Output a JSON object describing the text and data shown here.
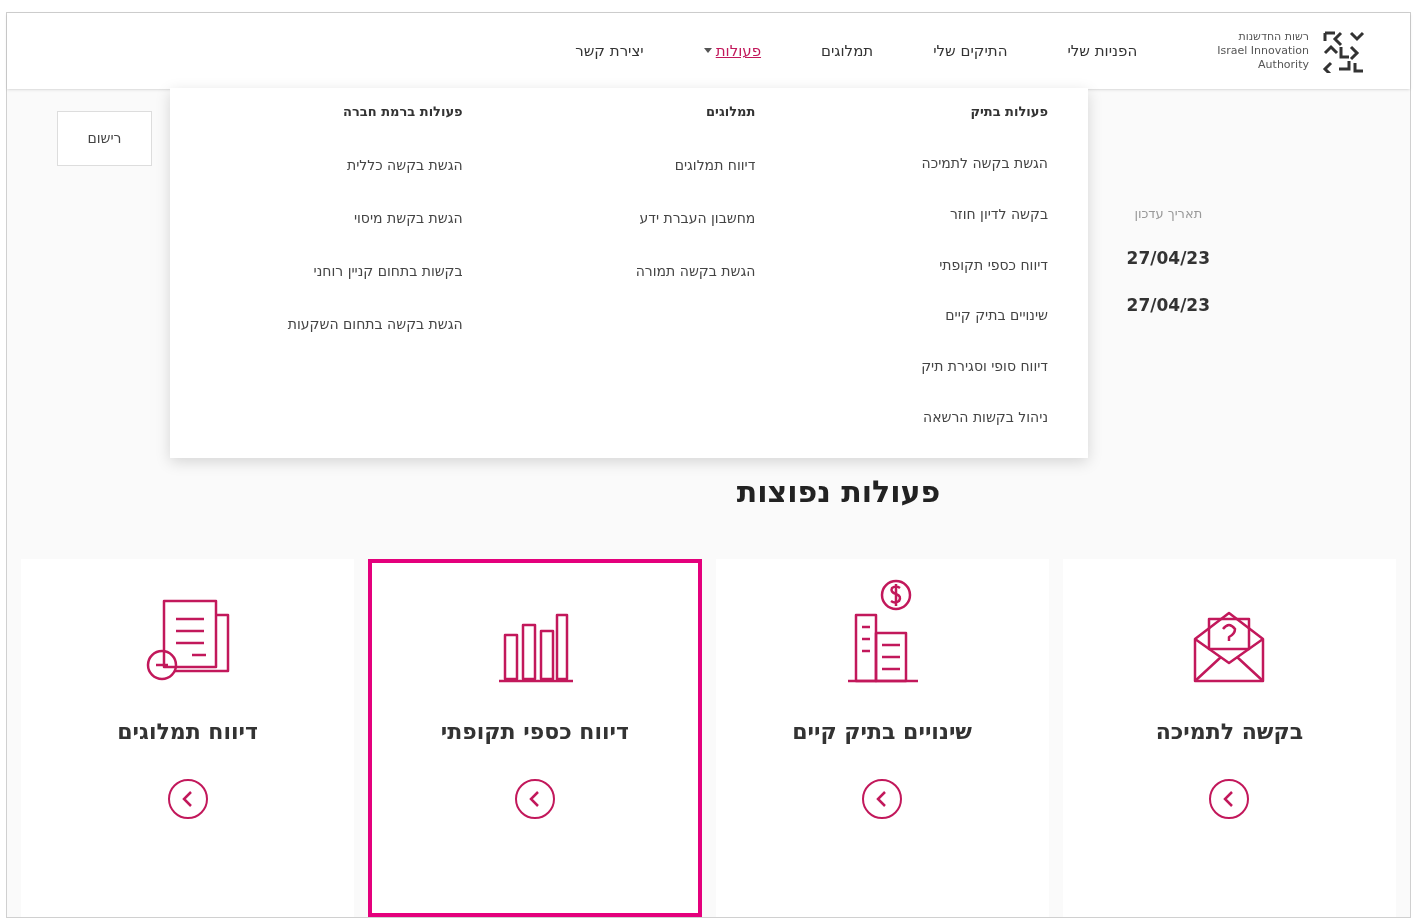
{
  "logo": {
    "lines": [
      "רשות החדשנות",
      "Israel Innovation",
      "Authority"
    ]
  },
  "nav": [
    {
      "label": "הפניות שלי",
      "selected": false,
      "kind": "link"
    },
    {
      "label": "התיקים שלי",
      "selected": false,
      "kind": "link"
    },
    {
      "label": "תמלוגים",
      "selected": false,
      "kind": "link"
    },
    {
      "label": "פעולות",
      "selected": true,
      "kind": "dropdown"
    },
    {
      "label": "יצירת קשר",
      "selected": false,
      "kind": "link"
    }
  ],
  "background": {
    "register_button": "רישום",
    "date_header": "תאריך עדכון",
    "dates": [
      "27/04/23",
      "27/04/23"
    ]
  },
  "dropdown": {
    "columns": [
      {
        "title": "פעולות בתיק",
        "items": [
          "הגשת בקשה לתמיכה",
          "בקשה לדיון חוזר",
          "דיווח כספי תקופתי",
          "שינויים בתיק קיים",
          "דיווח סופי וסגירת תיק",
          "ניהול בקשות הרשאה"
        ]
      },
      {
        "title": "תמלוגים",
        "items": [
          "דיווח תמלוגים",
          "מחשבון העברת ידע",
          "הגשת בקשה תמורה"
        ]
      },
      {
        "title": "פעולות ברמת חברה",
        "items": [
          "הגשת בקשה כללית",
          "הגשת בקשת מיסוי",
          "בקשות בתחום קניין רוחני",
          "הגשת בקשה בתחום השקעות"
        ]
      }
    ]
  },
  "section_title": "פעולות נפוצות",
  "cards": [
    {
      "label": "בקשה לתמיכה",
      "kind": "envelope",
      "highlighted": false
    },
    {
      "label": "שינויים בתיק קיים",
      "kind": "building",
      "highlighted": false
    },
    {
      "label": "דיווח כספי תקופתי",
      "kind": "chart",
      "highlighted": true
    },
    {
      "label": "דיווח תמלוגים",
      "kind": "document",
      "highlighted": false
    }
  ]
}
